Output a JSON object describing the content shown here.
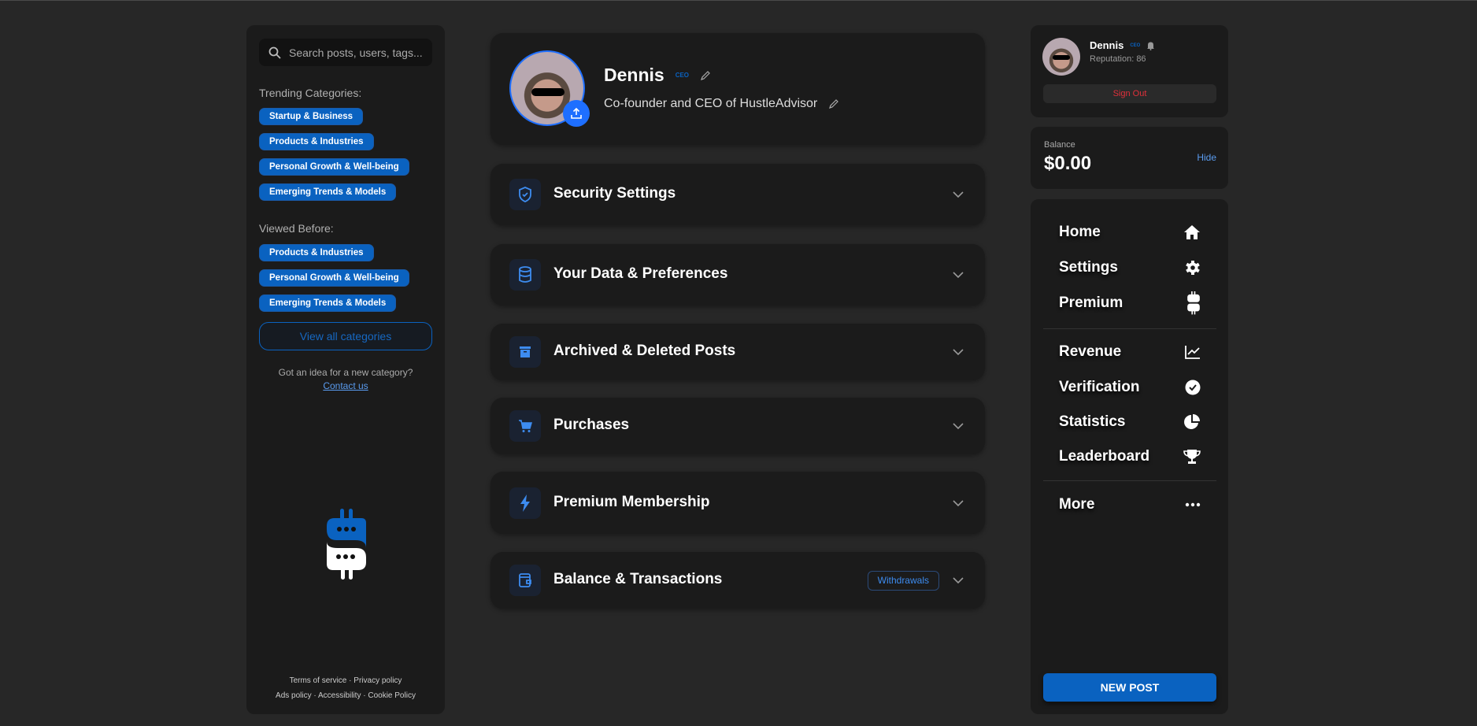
{
  "left": {
    "search_placeholder": "Search posts, users, tags...",
    "trending_label": "Trending Categories:",
    "trending": [
      "Startup & Business",
      "Products & Industries",
      "Personal Growth & Well-being",
      "Emerging Trends & Models"
    ],
    "viewed_label": "Viewed Before:",
    "viewed": [
      "Products & Industries",
      "Personal Growth & Well-being",
      "Emerging Trends & Models"
    ],
    "view_all": "View all categories",
    "idea_text": "Got an idea for a new category?",
    "contact": "Contact us",
    "footer": {
      "terms": "Terms of service",
      "privacy": "Privacy policy",
      "ads": "Ads policy",
      "accessibility": "Accessibility",
      "cookie": "Cookie Policy",
      "sep": "·"
    }
  },
  "profile": {
    "name": "Dennis",
    "badge": "CEO",
    "bio": "Co-founder and CEO of HustleAdvisor"
  },
  "sections": [
    {
      "title": "Security Settings",
      "icon": "shield-check-icon"
    },
    {
      "title": "Your Data & Preferences",
      "icon": "database-icon"
    },
    {
      "title": "Archived & Deleted Posts",
      "icon": "archive-icon"
    },
    {
      "title": "Purchases",
      "icon": "cart-icon"
    },
    {
      "title": "Premium Membership",
      "icon": "lightning-icon"
    },
    {
      "title": "Balance & Transactions",
      "icon": "wallet-icon",
      "action": "Withdrawals"
    }
  ],
  "user": {
    "name": "Dennis",
    "badge": "CEO",
    "reputation": "Reputation: 86",
    "sign_out": "Sign Out"
  },
  "balance": {
    "label": "Balance",
    "amount": "$0.00",
    "hide": "Hide"
  },
  "nav": {
    "items": [
      "Home",
      "Settings",
      "Premium",
      "Revenue",
      "Verification",
      "Statistics",
      "Leaderboard",
      "More"
    ],
    "new_post": "NEW POST"
  },
  "colors": {
    "accent": "#0a62c0",
    "upload": "#1e6fff",
    "danger": "#e0303a",
    "link": "#5a9cf0"
  }
}
